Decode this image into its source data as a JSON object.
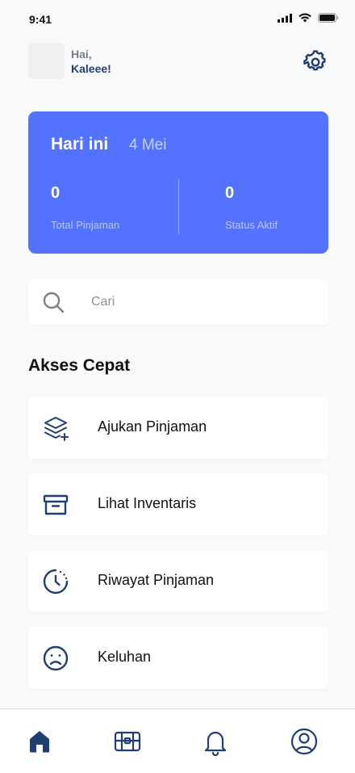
{
  "status_bar": {
    "time": "9:41"
  },
  "header": {
    "greeting": "Hai,",
    "name": "Kaleee!"
  },
  "summary": {
    "title": "Hari ini",
    "date": "4 Mei",
    "stats": [
      {
        "value": "0",
        "label": "Total Pinjaman"
      },
      {
        "value": "0",
        "label": "Status Aktif"
      }
    ]
  },
  "search": {
    "placeholder": "Cari"
  },
  "quick_access": {
    "title": "Akses Cepat",
    "items": [
      {
        "label": "Ajukan Pinjaman",
        "icon": "layers-plus-icon"
      },
      {
        "label": "Lihat Inventaris",
        "icon": "archive-box-icon"
      },
      {
        "label": "Riwayat Pinjaman",
        "icon": "history-clock-icon"
      },
      {
        "label": "Keluhan",
        "icon": "sad-face-icon"
      }
    ]
  },
  "nav": {
    "items": [
      {
        "icon": "home-icon",
        "active": true
      },
      {
        "icon": "inventory-icon",
        "active": false
      },
      {
        "icon": "bell-icon",
        "active": false
      },
      {
        "icon": "profile-icon",
        "active": false
      }
    ]
  },
  "colors": {
    "primary": "#5373ff",
    "navy": "#1f3e72",
    "background": "#f8f9fb"
  }
}
